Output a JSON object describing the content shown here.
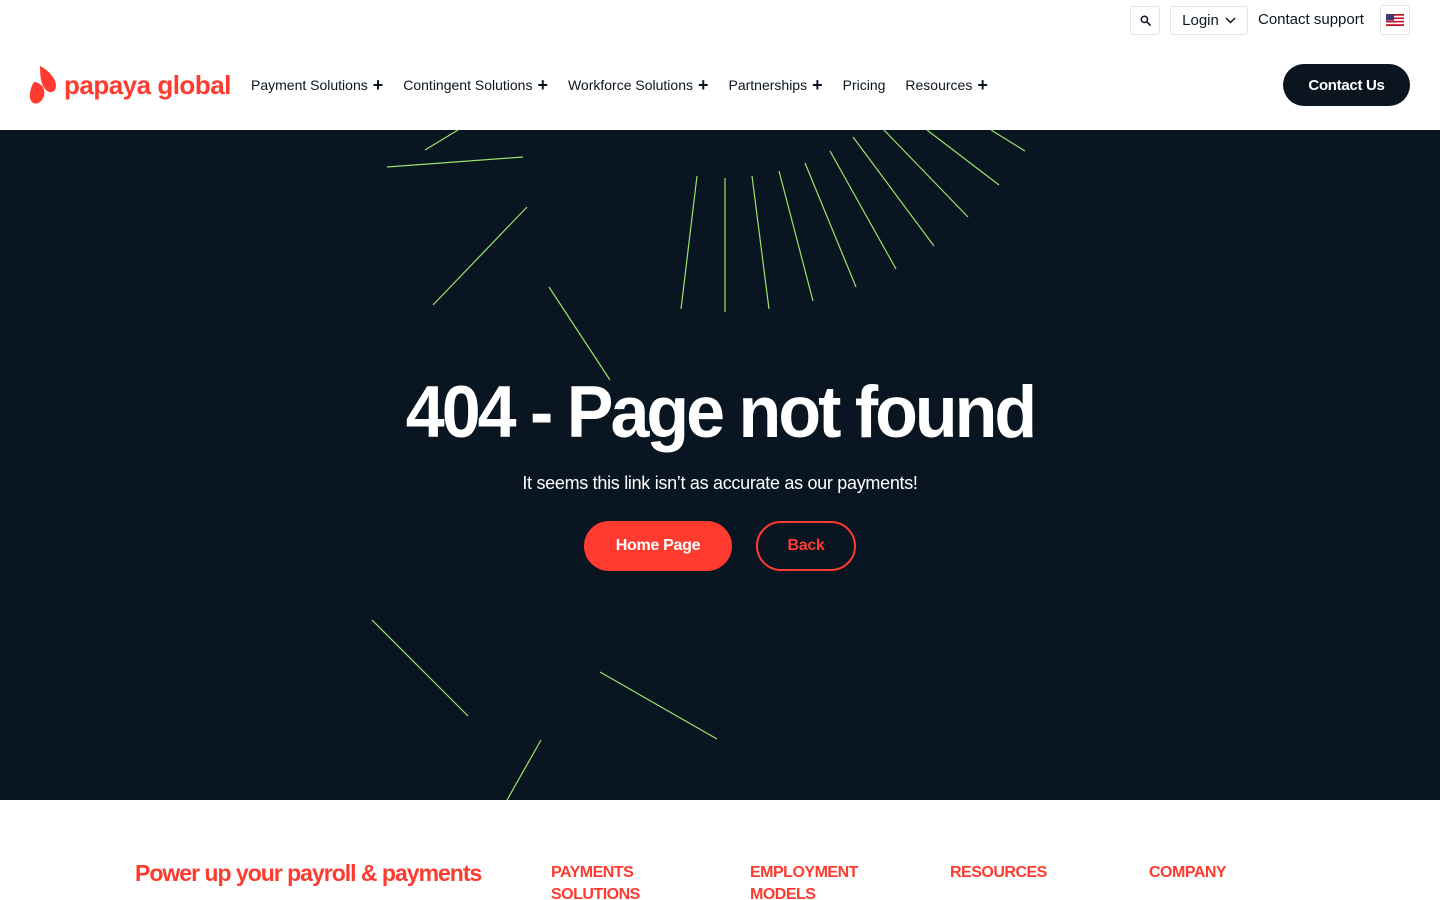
{
  "utility": {
    "login_label": "Login",
    "contact_support": "Contact support",
    "search_icon": "search-icon",
    "flag_icon": "us-flag-icon"
  },
  "header": {
    "logo_text": "papaya global",
    "nav": [
      {
        "label": "Payment Solutions",
        "has_plus": true
      },
      {
        "label": "Contingent Solutions",
        "has_plus": true
      },
      {
        "label": "Workforce Solutions",
        "has_plus": true
      },
      {
        "label": "Partnerships",
        "has_plus": true
      },
      {
        "label": "Pricing",
        "has_plus": false
      },
      {
        "label": "Resources",
        "has_plus": true
      }
    ],
    "contact_button": "Contact Us"
  },
  "hero": {
    "title": "404 - Page not found",
    "subtitle": "It seems this link isn’t as accurate as our payments!",
    "home_button": "Home Page",
    "back_button": "Back"
  },
  "footer": {
    "tagline": "Power up your payroll & payments",
    "columns": [
      "PAYMENTS SOLUTIONS",
      "EMPLOYMENT MODELS",
      "RESOURCES",
      "COMPANY"
    ]
  },
  "colors": {
    "brand_red": "#ff3b30",
    "navy": "#091521",
    "ray_green": "#9be36b"
  }
}
